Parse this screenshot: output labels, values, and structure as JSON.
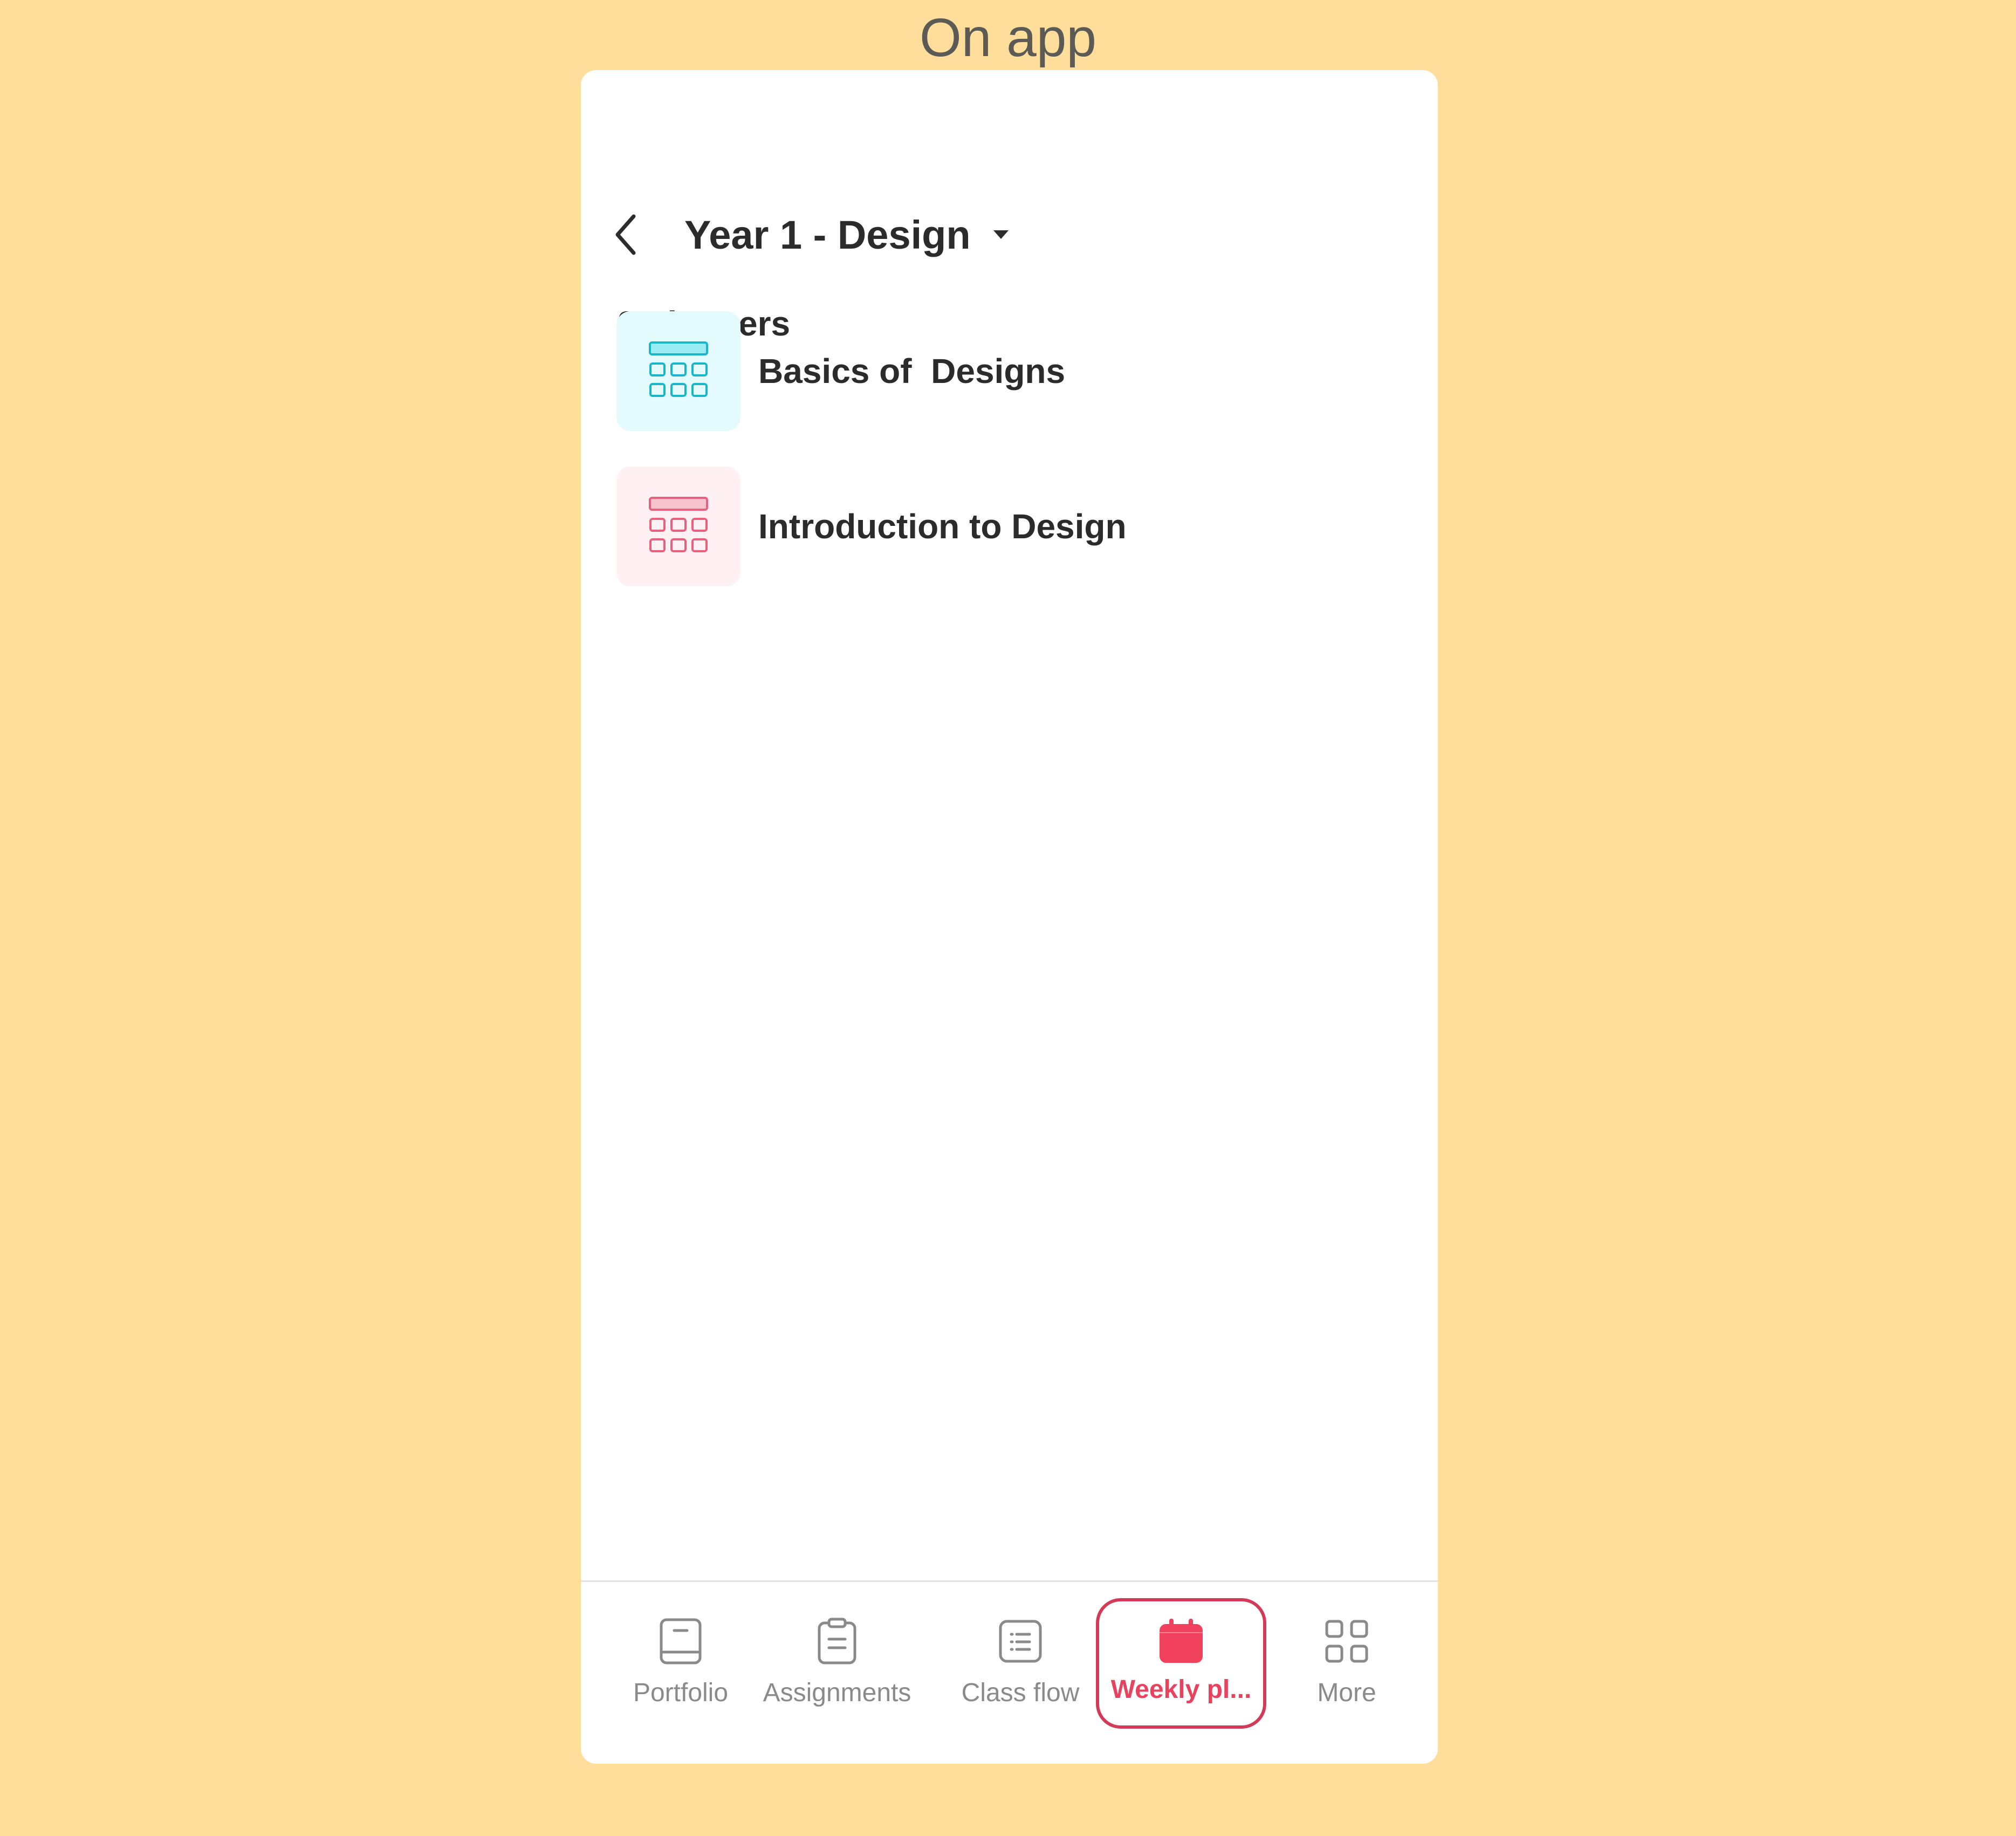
{
  "caption": "On app",
  "header": {
    "back_icon": "chevron-left-icon",
    "title": "Year 1 - Design",
    "dropdown_icon": "caret-down-icon"
  },
  "planner_count": "2 planners",
  "planners": [
    {
      "label": "Basics of  Designs",
      "icon": "calendar-grid-icon",
      "color": "#19B6C9",
      "tile_color": "#E4FBFE"
    },
    {
      "label": "Introduction to Design",
      "icon": "calendar-grid-icon",
      "color": "#E9607F",
      "tile_color": "#FFF0F3"
    }
  ],
  "tabs": [
    {
      "label": "Portfolio",
      "icon": "portfolio-icon"
    },
    {
      "label": "Assignments",
      "icon": "clipboard-icon"
    },
    {
      "label": "Class flow",
      "icon": "list-icon"
    },
    {
      "label": "Weekly pl...",
      "icon": "calendar-icon",
      "active": true
    },
    {
      "label": "More",
      "icon": "grid-icon"
    }
  ],
  "colors": {
    "background": "#FEDE9A",
    "accent": "#E8425F",
    "active_outline": "#D23A58"
  }
}
